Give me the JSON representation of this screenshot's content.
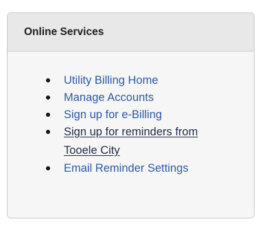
{
  "panel": {
    "title": "Online Services",
    "links": [
      {
        "label": "Utility Billing Home"
      },
      {
        "label": "Manage Accounts"
      },
      {
        "label": "Sign up for e-Billing"
      },
      {
        "label_line1": "Sign up for reminders from",
        "label_line2": "Tooele City"
      },
      {
        "label": "Email Reminder Settings"
      }
    ]
  }
}
